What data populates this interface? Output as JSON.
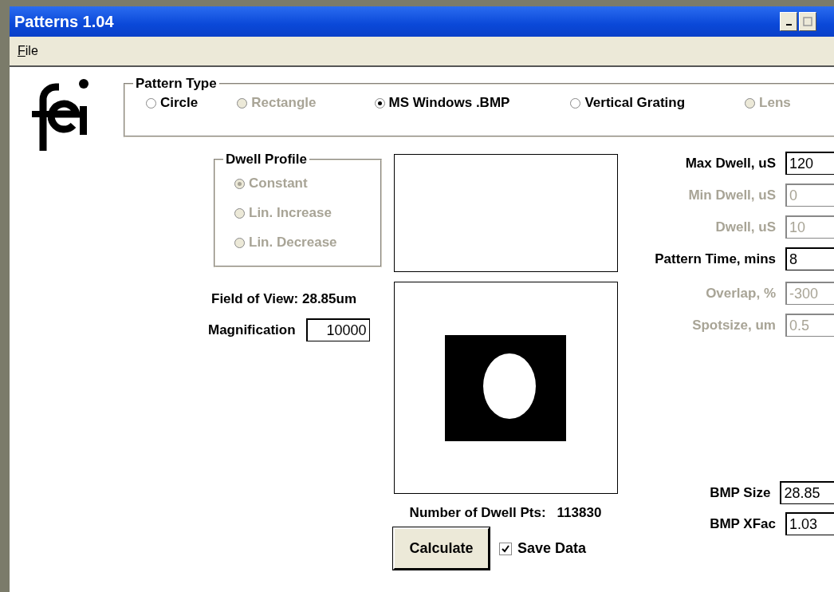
{
  "window": {
    "title": "Patterns 1.04"
  },
  "menu": [
    {
      "label": "File"
    }
  ],
  "pattern_type": {
    "title": "Pattern Type",
    "options": [
      {
        "label": "Circle",
        "selected": false,
        "disabled": false
      },
      {
        "label": "Rectangle",
        "selected": false,
        "disabled": true
      },
      {
        "label": "MS Windows .BMP",
        "selected": true,
        "disabled": false
      },
      {
        "label": "Vertical Grating",
        "selected": false,
        "disabled": false
      },
      {
        "label": "Lens",
        "selected": false,
        "disabled": true
      }
    ]
  },
  "dwell_profile": {
    "title": "Dwell Profile",
    "options": [
      {
        "label": "Constant",
        "selected": true,
        "disabled": true
      },
      {
        "label": "Lin. Increase",
        "selected": false,
        "disabled": true
      },
      {
        "label": "Lin. Decrease",
        "selected": false,
        "disabled": true
      }
    ]
  },
  "field_of_view": "Field of View: 28.85um",
  "magnification": {
    "label": "Magnification",
    "value": "10000"
  },
  "dwell_points": {
    "label": "Number of Dwell Pts:",
    "value": "113830"
  },
  "calculate_button": "Calculate",
  "save_data": {
    "label": "Save Data",
    "checked": true
  },
  "parameters": [
    {
      "label": "Max Dwell, uS",
      "value": "120",
      "disabled": false
    },
    {
      "label": "Min Dwell, uS",
      "value": "0",
      "disabled": true
    },
    {
      "label": "Dwell, uS",
      "value": "10",
      "disabled": true
    },
    {
      "label": "Pattern Time, mins",
      "value": "8",
      "disabled": false
    },
    {
      "label": "Overlap, %",
      "value": "-300",
      "disabled": true
    },
    {
      "label": "Spotsize, um",
      "value": "0.5",
      "disabled": true
    }
  ],
  "bmp_parameters": [
    {
      "label": "BMP Size",
      "value": "28.85",
      "disabled": false
    },
    {
      "label": "BMP XFac",
      "value": "1.03",
      "disabled": false
    }
  ]
}
